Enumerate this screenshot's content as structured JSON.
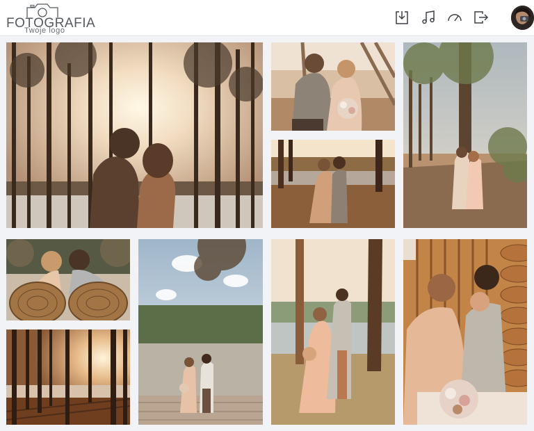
{
  "header": {
    "logo_title": "FOTOGRAFIA",
    "logo_subtitle": "Twoje logo",
    "icons": [
      "download-icon",
      "music-icon",
      "speedometer-icon",
      "logout-icon"
    ],
    "avatar": "user-avatar"
  },
  "colors": {
    "background": "#f1f3f6",
    "header_bg": "#ffffff",
    "icon_stroke": "#3b3f45"
  },
  "gallery": {
    "photos": [
      {
        "name": "photo-forest-sunset-couple"
      },
      {
        "name": "photo-couple-bench-bouquet"
      },
      {
        "name": "photo-couple-lakeside-standing"
      },
      {
        "name": "photo-couple-palm-path"
      },
      {
        "name": "photo-couple-wicker-chairs"
      },
      {
        "name": "photo-couple-lake-dock"
      },
      {
        "name": "photo-couple-trees-embrace"
      },
      {
        "name": "photo-couple-wooden-cabin"
      },
      {
        "name": "photo-forest-sun-trees"
      }
    ]
  }
}
